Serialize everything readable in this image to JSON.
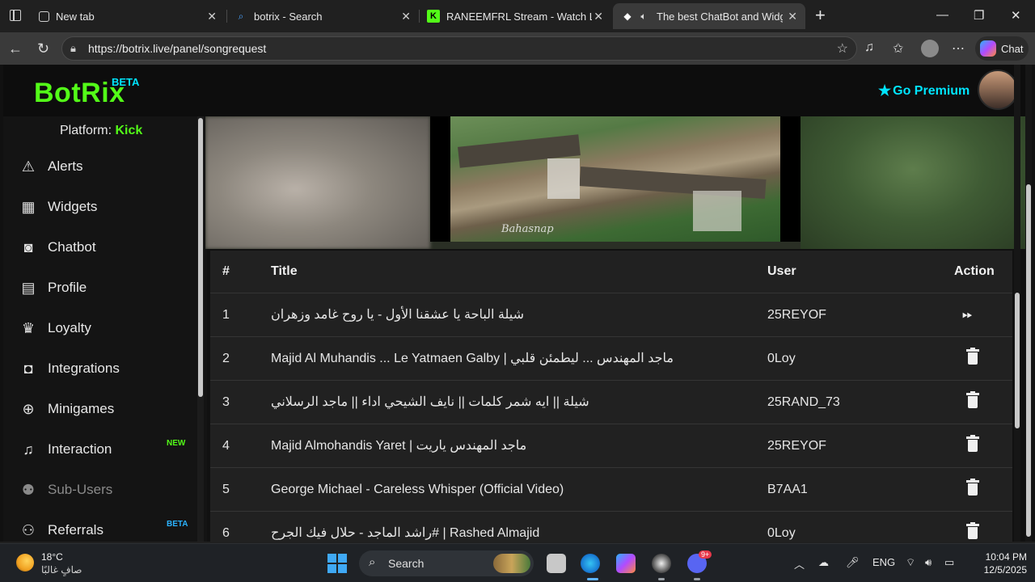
{
  "browser": {
    "tabs": [
      {
        "title": "New tab",
        "icon": "new-tab-icon",
        "close": "✕"
      },
      {
        "title": "botrix - Search",
        "icon": "search-icon",
        "close": "✕"
      },
      {
        "title": "RANEEMFRL Stream - Watch Live on Kick",
        "icon": "kick-icon",
        "close": "✕"
      },
      {
        "title": "The best ChatBot and Widgets for Kick",
        "icon": "botrix-icon",
        "close": "✕"
      }
    ],
    "new_tab": "+",
    "url": "https://botrix.live/panel/songrequest",
    "copilot_label": "Chat"
  },
  "app": {
    "brand": "BotRix",
    "brand_tag": "BETA",
    "premium_label": "Go Premium",
    "platform_label": "Platform:",
    "platform_value": "Kick",
    "brand_color": "#53fc18",
    "accent_color": "#00e5ff"
  },
  "sidebar": {
    "items": [
      {
        "label": "Alerts",
        "icon": "warning-icon",
        "badge": ""
      },
      {
        "label": "Widgets",
        "icon": "grid-icon",
        "badge": ""
      },
      {
        "label": "Chatbot",
        "icon": "robot-icon",
        "badge": ""
      },
      {
        "label": "Profile",
        "icon": "id-card-icon",
        "badge": ""
      },
      {
        "label": "Loyalty",
        "icon": "trophy-icon",
        "badge": ""
      },
      {
        "label": "Integrations",
        "icon": "discord-icon",
        "badge": ""
      },
      {
        "label": "Minigames",
        "icon": "gamepad-icon",
        "badge": ""
      },
      {
        "label": "Interaction",
        "icon": "music-icon",
        "badge": "NEW"
      },
      {
        "label": "Sub-Users",
        "icon": "users-icon",
        "badge": ""
      },
      {
        "label": "Referrals",
        "icon": "user-group-icon",
        "badge": "BETA"
      }
    ]
  },
  "video": {
    "watermark": "Bahasnap"
  },
  "songs": {
    "headers": {
      "num": "#",
      "title": "Title",
      "user": "User",
      "action": "Action"
    },
    "rows": [
      {
        "num": "1",
        "title": "شيلة الباحة يا عشقنا الأول - يا روح غامد وزهران",
        "user": "25REYOF",
        "action": "skip"
      },
      {
        "num": "2",
        "title": "Majid Al Muhandis ... Le Yatmaen Galby | ماجد المهندس ... ليطمئن قلبي",
        "user": "0Loy",
        "action": "delete"
      },
      {
        "num": "3",
        "title": "شيلة || ايه شمر كلمات || نايف الشيحي اداء || ماجد الرسلاني",
        "user": "25RAND_73",
        "action": "delete"
      },
      {
        "num": "4",
        "title": "Majid Almohandis Yaret | ماجد المهندس ياريت",
        "user": "25REYOF",
        "action": "delete"
      },
      {
        "num": "5",
        "title": "George Michael - Careless Whisper (Official Video)",
        "user": "B7AA1",
        "action": "delete"
      },
      {
        "num": "6",
        "title": "راشد الماجد - حلال فيك الجرح# | Rashed Almajid",
        "user": "0Loy",
        "action": "delete"
      }
    ]
  },
  "taskbar": {
    "temp": "18°C",
    "weather": "صافٍ غالبًا",
    "search_label": "Search",
    "lang": "ENG",
    "time": "10:04 PM",
    "date": "12/5/2025",
    "discord_badge": "9+"
  }
}
